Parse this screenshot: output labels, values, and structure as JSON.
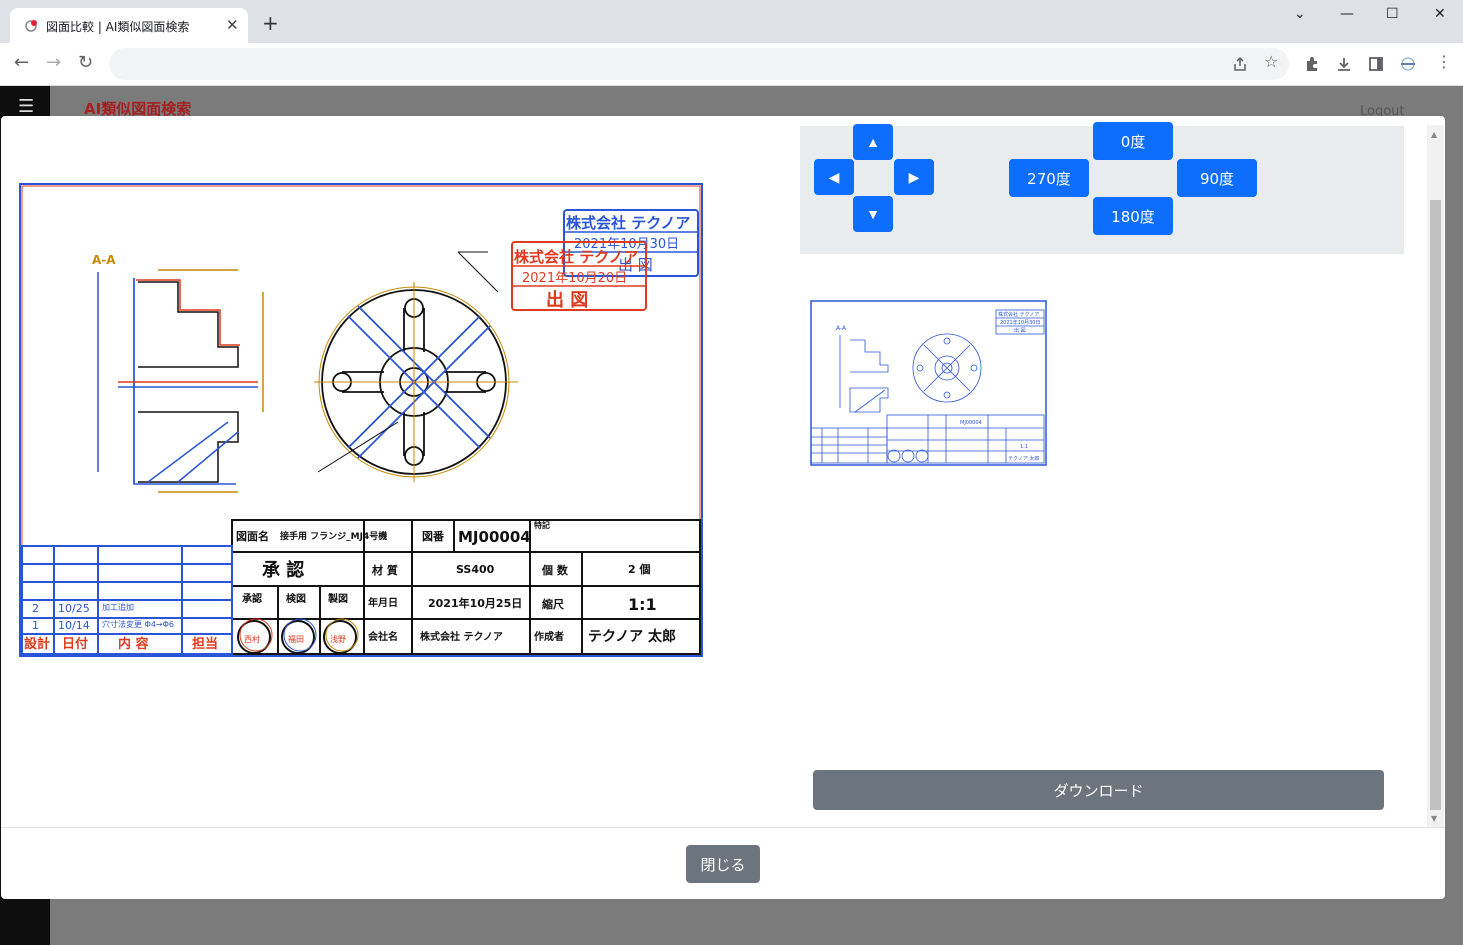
{
  "browser": {
    "tab_title": "図面比較 | AI類似図面検索",
    "tab_close": "✕",
    "new_tab": "+",
    "window_controls": [
      "⌄",
      "—",
      "☐",
      "✕"
    ]
  },
  "app": {
    "logo": "AI類似図面検索",
    "logout": "Logout"
  },
  "controls": {
    "up": "▲",
    "left": "◀",
    "right": "▶",
    "down": "▼",
    "rot_0": "0度",
    "rot_90": "90度",
    "rot_180": "180度",
    "rot_270": "270度"
  },
  "drawing": {
    "section_label": "A-A",
    "stamp_blue_company": "株式会社 テクノア",
    "stamp_blue_date": "2021年10月30日",
    "stamp_red_company": "株式会社 テクノア",
    "stamp_red_date": "2021年10月20日",
    "stamp_text": "出 図",
    "title_block": {
      "drawing_name_label": "図面名",
      "drawing_name": "接手用 フランジ_MJ4号機",
      "drawing_no_label": "図番",
      "drawing_no": "MJ00004",
      "notes_label": "特記",
      "approval": "承 認",
      "material_label": "材 質",
      "material": "SS400",
      "qty_label": "個 数",
      "qty": "2 個",
      "approve_small": "承認",
      "check": "検図",
      "draw": "製図",
      "date_label": "年月日",
      "date": "2021年10月25日",
      "scale_label": "縮尺",
      "scale": "1:1",
      "company_label": "会社名",
      "company": "株式会社 テクノア",
      "author_label": "作成者",
      "author": "テクノア 太郎",
      "seal_1": "西村",
      "seal_2": "福田",
      "seal_3": "浅野"
    },
    "revision": {
      "row2_no": "2",
      "row2_date": "10/25",
      "row2_content": "加工追加",
      "row1_no": "1",
      "row1_date": "10/14",
      "row1_content": "穴寸法変更 Φ4→Φ6",
      "header_no": "設計",
      "header_date": "日付",
      "header_content": "内 容",
      "header_person": "担当"
    }
  },
  "thumbnail": {
    "section_label": "A-A",
    "stamp_company": "株式会社 テクノア",
    "stamp_date": "2021年10月30日",
    "stamp_text": "出 図",
    "drawing_no": "MJ00004",
    "scale": "1:1",
    "author": "テクノア 太郎"
  },
  "buttons": {
    "download": "ダウンロード",
    "close": "閉じる"
  },
  "colors": {
    "primary": "#0d6efd",
    "secondary": "#6c757d",
    "drawing_blue": "#2a55d8",
    "drawing_red": "#e03a1e",
    "panel_bg": "#e9ecef"
  }
}
